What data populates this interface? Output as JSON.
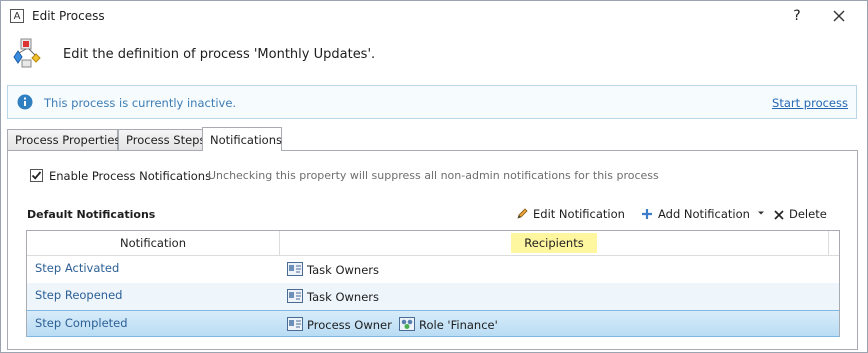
{
  "window": {
    "app_icon_letter": "A",
    "title": "Edit Process",
    "help_label": "?"
  },
  "header": {
    "text": "Edit the definition of process 'Monthly Updates'."
  },
  "info": {
    "message": "This process is currently inactive.",
    "action": "Start process"
  },
  "tabs": [
    {
      "label": "Process Properties"
    },
    {
      "label": "Process Steps"
    },
    {
      "label": "Notifications",
      "active": true
    }
  ],
  "notifications": {
    "enable_label": "Enable Process Notifications",
    "enable_checked": true,
    "enable_hint": "Unchecking this property will suppress all non-admin notifications for this process",
    "section_title": "Default Notifications",
    "toolbar": {
      "edit": "Edit Notification",
      "add": "Add Notification",
      "delete": "Delete"
    },
    "columns": {
      "notification": "Notification",
      "recipients": "Recipients"
    },
    "rows": [
      {
        "name": "Step Activated",
        "recipients": [
          {
            "label": "Task Owners",
            "icon": "user-card-icon"
          }
        ]
      },
      {
        "name": "Step Reopened",
        "recipients": [
          {
            "label": "Task Owners",
            "icon": "user-card-icon"
          }
        ]
      },
      {
        "name": "Step Completed",
        "selected": true,
        "recipients": [
          {
            "label": "Process Owner",
            "icon": "user-card-icon"
          },
          {
            "label": "Role 'Finance'",
            "icon": "role-group-icon"
          }
        ]
      }
    ]
  },
  "colors": {
    "accent_link": "#2468b3",
    "info_text": "#3d7db5",
    "recipients_highlight": "#fff6a0",
    "row_selected": "#c7e4f8"
  }
}
